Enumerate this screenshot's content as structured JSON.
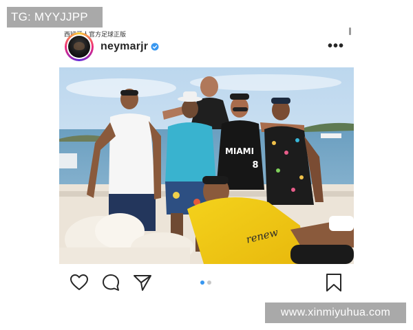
{
  "watermarks": {
    "telegram": "TG: MYYJJPP",
    "website": "www.xinmiyuhua.com"
  },
  "caption_text": "西班牙人官方足球正版",
  "post": {
    "username": "neymarjr",
    "verified": true,
    "more_label": "•••",
    "photo_text": {
      "shirt_text": "MIAMI",
      "shirt_number": "8",
      "hoodie_text": "renew"
    },
    "carousel": {
      "total": 2,
      "active": 1
    }
  },
  "icons": {
    "like": "heart-icon",
    "comment": "comment-icon",
    "share": "send-icon",
    "save": "bookmark-icon",
    "verified": "verified-badge-icon",
    "more": "more-options-icon"
  },
  "colors": {
    "badge_bg": "#a9a9a9",
    "verified_blue": "#3897f0",
    "dot_active": "#3897f0",
    "dot_inactive": "#c7c7c7",
    "text_dark": "#262626"
  }
}
